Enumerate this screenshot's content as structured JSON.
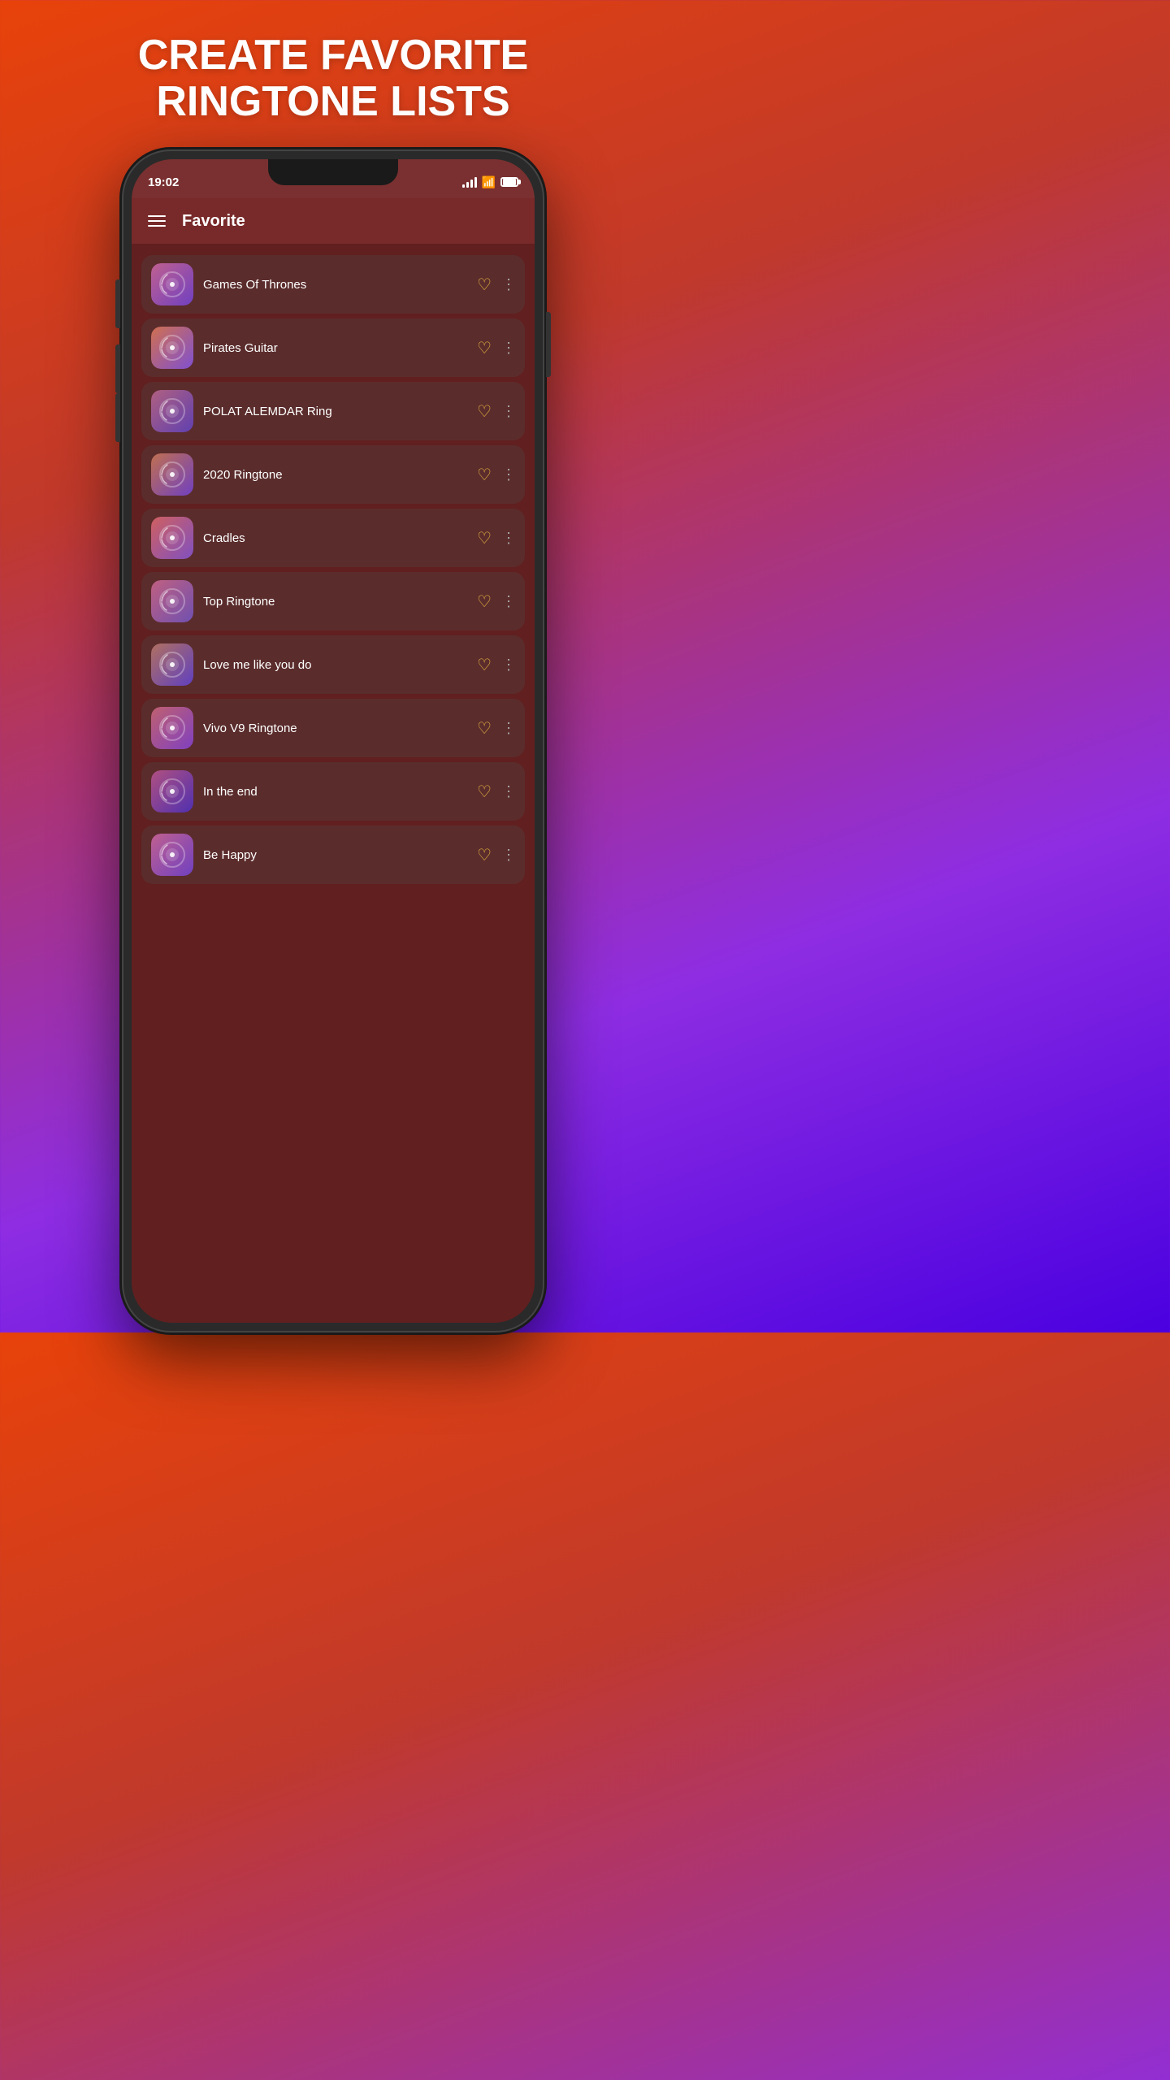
{
  "header": {
    "title": "CREATE FAVORITE\nRINGTONE LISTS"
  },
  "status_bar": {
    "time": "19:02"
  },
  "app": {
    "title": "Favorite"
  },
  "ringtones": [
    {
      "id": 1,
      "name": "Games Of Thrones",
      "gradient": [
        "#c06090",
        "#7040c0"
      ]
    },
    {
      "id": 2,
      "name": "Pirates Guitar",
      "gradient": [
        "#d07050",
        "#8050d0"
      ]
    },
    {
      "id": 3,
      "name": "POLAT ALEMDAR Ring",
      "gradient": [
        "#b06080",
        "#6040b0"
      ]
    },
    {
      "id": 4,
      "name": "2020 Ringtone",
      "gradient": [
        "#c07050",
        "#7040c0"
      ]
    },
    {
      "id": 5,
      "name": "Cradles",
      "gradient": [
        "#d06060",
        "#8050c0"
      ]
    },
    {
      "id": 6,
      "name": "Top Ringtone",
      "gradient": [
        "#c06080",
        "#7050b0"
      ]
    },
    {
      "id": 7,
      "name": "Love me like you do",
      "gradient": [
        "#b07060",
        "#6040c0"
      ]
    },
    {
      "id": 8,
      "name": "Vivo V9 Ringtone",
      "gradient": [
        "#c06070",
        "#8040c0"
      ]
    },
    {
      "id": 9,
      "name": "In the end",
      "gradient": [
        "#b05080",
        "#5030b0"
      ]
    },
    {
      "id": 10,
      "name": "Be Happy",
      "gradient": [
        "#c06090",
        "#7040c0"
      ]
    }
  ]
}
